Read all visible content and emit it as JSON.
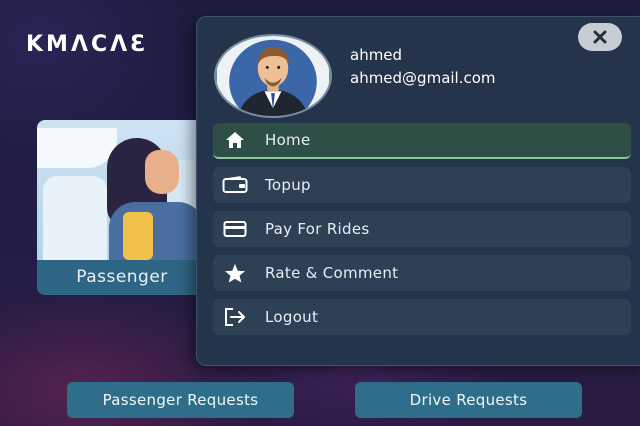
{
  "app": {
    "logo_text": "KMɅCɅƐ"
  },
  "background_card": {
    "label": "Passenger"
  },
  "bottom_buttons": {
    "passenger_requests": "Passenger Requests",
    "drive_requests": "Drive Requests"
  },
  "drawer": {
    "user": {
      "name": "ahmed",
      "email": "ahmed@gmail.com"
    },
    "close_icon": "close-icon",
    "menu": [
      {
        "label": "Home",
        "icon": "home-icon",
        "active": true
      },
      {
        "label": "Topup",
        "icon": "wallet-icon",
        "active": false
      },
      {
        "label": "Pay For Rides",
        "icon": "credit-card-icon",
        "active": false
      },
      {
        "label": "Rate & Comment",
        "icon": "star-icon",
        "active": false
      },
      {
        "label": "Logout",
        "icon": "logout-icon",
        "active": false
      }
    ]
  },
  "colors": {
    "background": "#1b1c3d",
    "drawer": "#24344a",
    "menu_item": "#2d4054",
    "active_item": "#2d4f46",
    "button": "#2f6e8a"
  }
}
